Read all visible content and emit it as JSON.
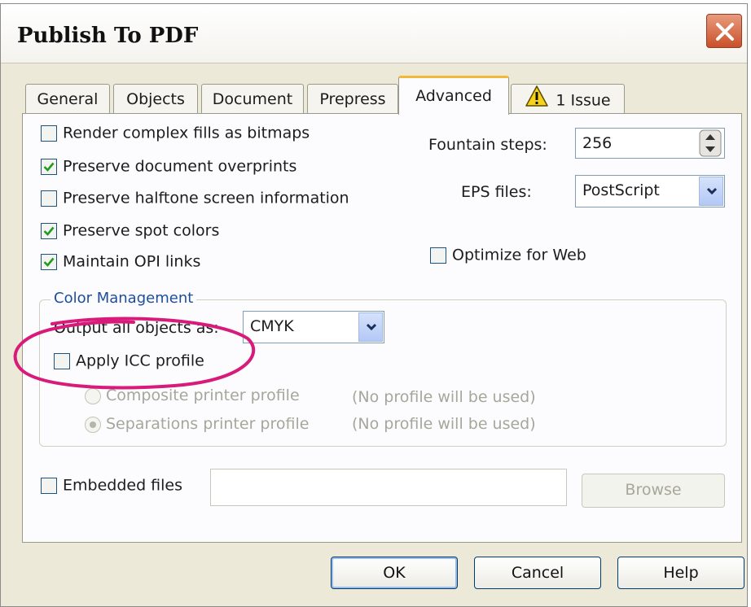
{
  "window": {
    "title": "Publish To PDF"
  },
  "tabs": [
    {
      "label": "General"
    },
    {
      "label": "Objects"
    },
    {
      "label": "Document"
    },
    {
      "label": "Prepress"
    },
    {
      "label": "Advanced"
    },
    {
      "label": "1 Issue",
      "icon": "warning-icon"
    }
  ],
  "active_tab": "Advanced",
  "options": {
    "render_complex_fills": {
      "label": "Render complex fills as bitmaps",
      "checked": false
    },
    "preserve_overprints": {
      "label": "Preserve document overprints",
      "checked": true
    },
    "preserve_halftone": {
      "label": "Preserve halftone screen information",
      "checked": false
    },
    "preserve_spot_colors": {
      "label": "Preserve spot colors",
      "checked": true
    },
    "maintain_opi": {
      "label": "Maintain OPI links",
      "checked": true
    },
    "optimize_web": {
      "label": "Optimize for Web",
      "checked": false
    }
  },
  "fountain_steps": {
    "label": "Fountain steps:",
    "value": "256"
  },
  "eps_files": {
    "label": "EPS files:",
    "value": "PostScript"
  },
  "color_management": {
    "title": "Color Management",
    "output_label": "Output all objects as:",
    "output_value": "CMYK",
    "apply_icc": {
      "label": "Apply ICC profile",
      "checked": false
    },
    "composite": {
      "label": "Composite printer profile",
      "note": "(No profile will be used)",
      "selected": false
    },
    "separations": {
      "label": "Separations printer profile",
      "note": "(No profile will be used)",
      "selected": true
    }
  },
  "embedded_files": {
    "label": "Embedded files",
    "checked": false,
    "value": ""
  },
  "buttons": {
    "browse": "Browse",
    "ok": "OK",
    "cancel": "Cancel",
    "help": "Help"
  },
  "colors": {
    "annotation_circle": "#d81b7a",
    "tab_highlight": "#f3b83a",
    "group_title": "#1c4e9a"
  }
}
